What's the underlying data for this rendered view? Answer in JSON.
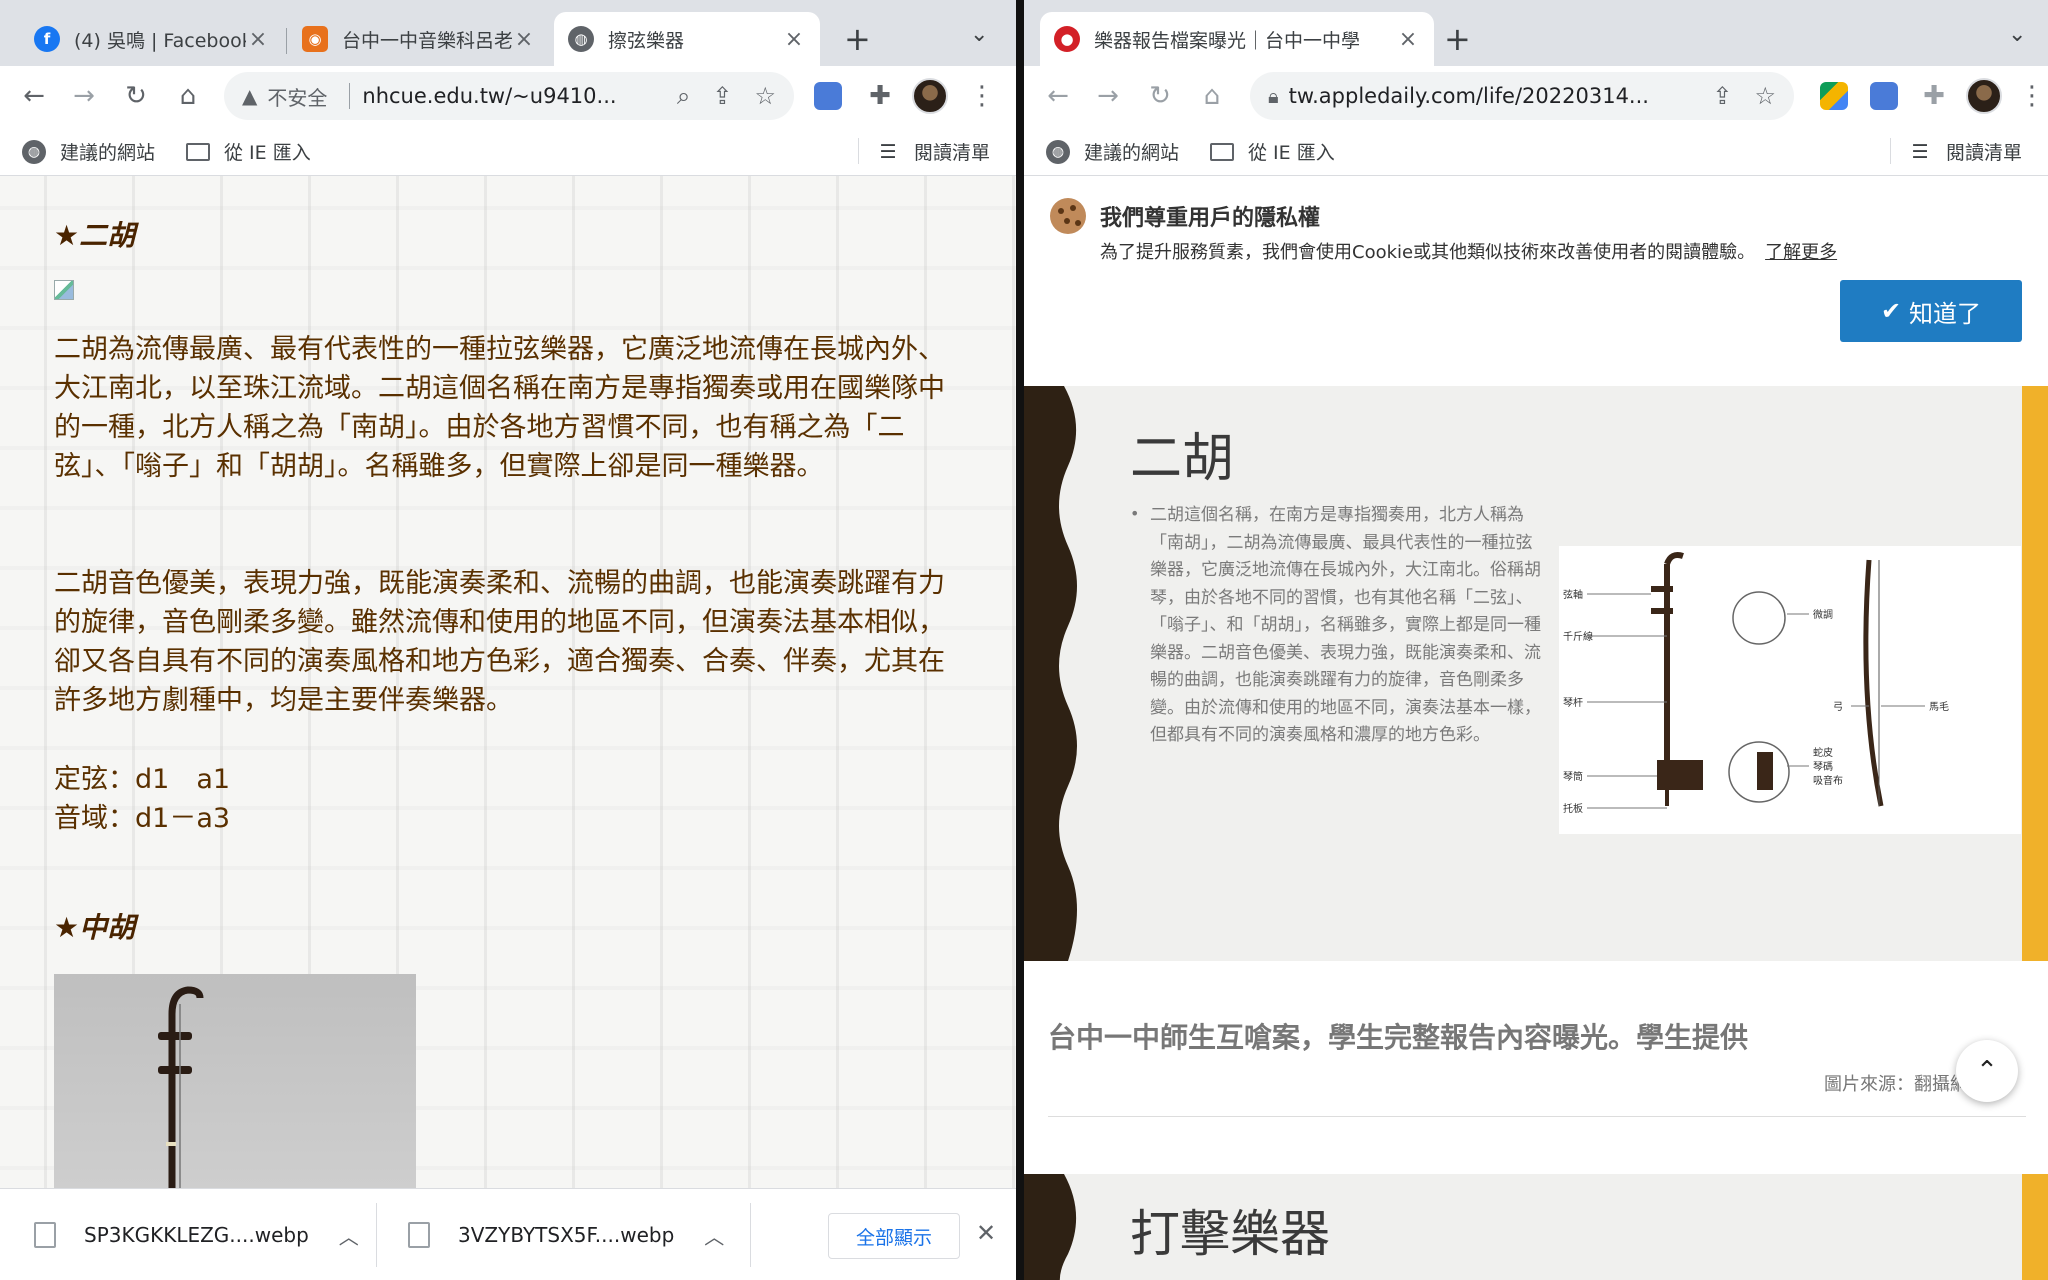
{
  "left_window": {
    "tabs": [
      {
        "title": "(4) 吳鳴 | Facebook",
        "favicon": "facebook-icon"
      },
      {
        "title": "台中一中音樂科呂老",
        "favicon": "site-icon"
      },
      {
        "title": "擦弦樂器",
        "favicon": "globe-icon",
        "active": true
      }
    ],
    "address": {
      "security": "不安全",
      "url": "nhcue.edu.tw/~u9410..."
    },
    "bookmarks": {
      "suggested": "建議的網站",
      "ie": "從 IE 匯入",
      "reading_list": "閱讀清單"
    },
    "page": {
      "erhu_heading": "★二胡",
      "erhu_p1": "二胡為流傳最廣、最有代表性的一種拉弦樂器，它廣泛地流傳在長城內外、大江南北，以至珠江流域。二胡這個名稱在南方是專指獨奏或用在國樂隊中的一種，北方人稱之為「南胡」。由於各地方習慣不同，也有稱之為「二弦」、「嗡子」和「胡胡」。名稱雖多，但實際上卻是同一種樂器。",
      "erhu_p2": "二胡音色優美，表現力強，既能演奏柔和、流暢的曲調，也能演奏跳躍有力的旋律，音色剛柔多變。雖然流傳和使用的地區不同，但演奏法基本相似，卻又各自具有不同的演奏風格和地方色彩，適合獨奏、合奏、伴奏，尤其在許多地方劇種中，均是主要伴奏樂器。",
      "tuning": "定弦：d1　a1",
      "range": "音域：d1－a3",
      "zhonghu_heading": "★中胡"
    },
    "downloads": {
      "file1": "SP3KGKKLEZG....webp",
      "file2": "3VZYBYTSX5F....webp",
      "show_all": "全部顯示"
    }
  },
  "right_window": {
    "tabs": [
      {
        "title": "樂器報告檔案曝光｜台中一中學",
        "favicon": "apple-daily-icon",
        "active": true
      }
    ],
    "address": {
      "url": "tw.appledaily.com/life/20220314..."
    },
    "bookmarks": {
      "suggested": "建議的網站",
      "ie": "從 IE 匯入",
      "reading_list": "閱讀清單"
    },
    "cookie": {
      "title": "我們尊重用戶的隱私權",
      "text": "為了提升服務質素，我們會使用Cookie或其他類似技術來改善使用者的閱讀體驗。",
      "more": "了解更多",
      "ok": "知道了"
    },
    "slide": {
      "title": "二胡",
      "text": "二胡這個名稱，在南方是專指獨奏用，北方人稱為「南胡」，二胡為流傳最廣、最具代表性的一種拉弦樂器，它廣泛地流傳在長城內外，大江南北。俗稱胡琴，由於各地不同的習慣，也有其他名稱「二弦」、「嗡子」、和「胡胡」，名稱雖多，實際上都是同一種樂器。二胡音色優美、表現力強，既能演奏柔和、流暢的曲調，也能演奏跳躍有力的旋律，音色剛柔多變。由於流傳和使用的地區不同，演奏法基本一樣，但都具有不同的演奏風格和濃厚的地方色彩。",
      "diagram_labels": {
        "a": "弦軸",
        "b": "千斤線",
        "c": "琴杆",
        "d": "琴筒",
        "e": "托板",
        "f": "微調",
        "g": "弓",
        "h": "馬毛",
        "i": "蛇皮",
        "j": "琴碼",
        "k": "吸音布"
      }
    },
    "caption": "台中一中師生互嗆案，學生完整報告內容曝光。學生提供",
    "credit": "圖片來源：翻攝網",
    "slide2_title": "打擊樂器"
  },
  "colors": {
    "page_text": "#5a3000",
    "accent_blue": "#1f7cc2",
    "slide_bar": "#f0b12a",
    "slide_wave": "#2e2114"
  }
}
